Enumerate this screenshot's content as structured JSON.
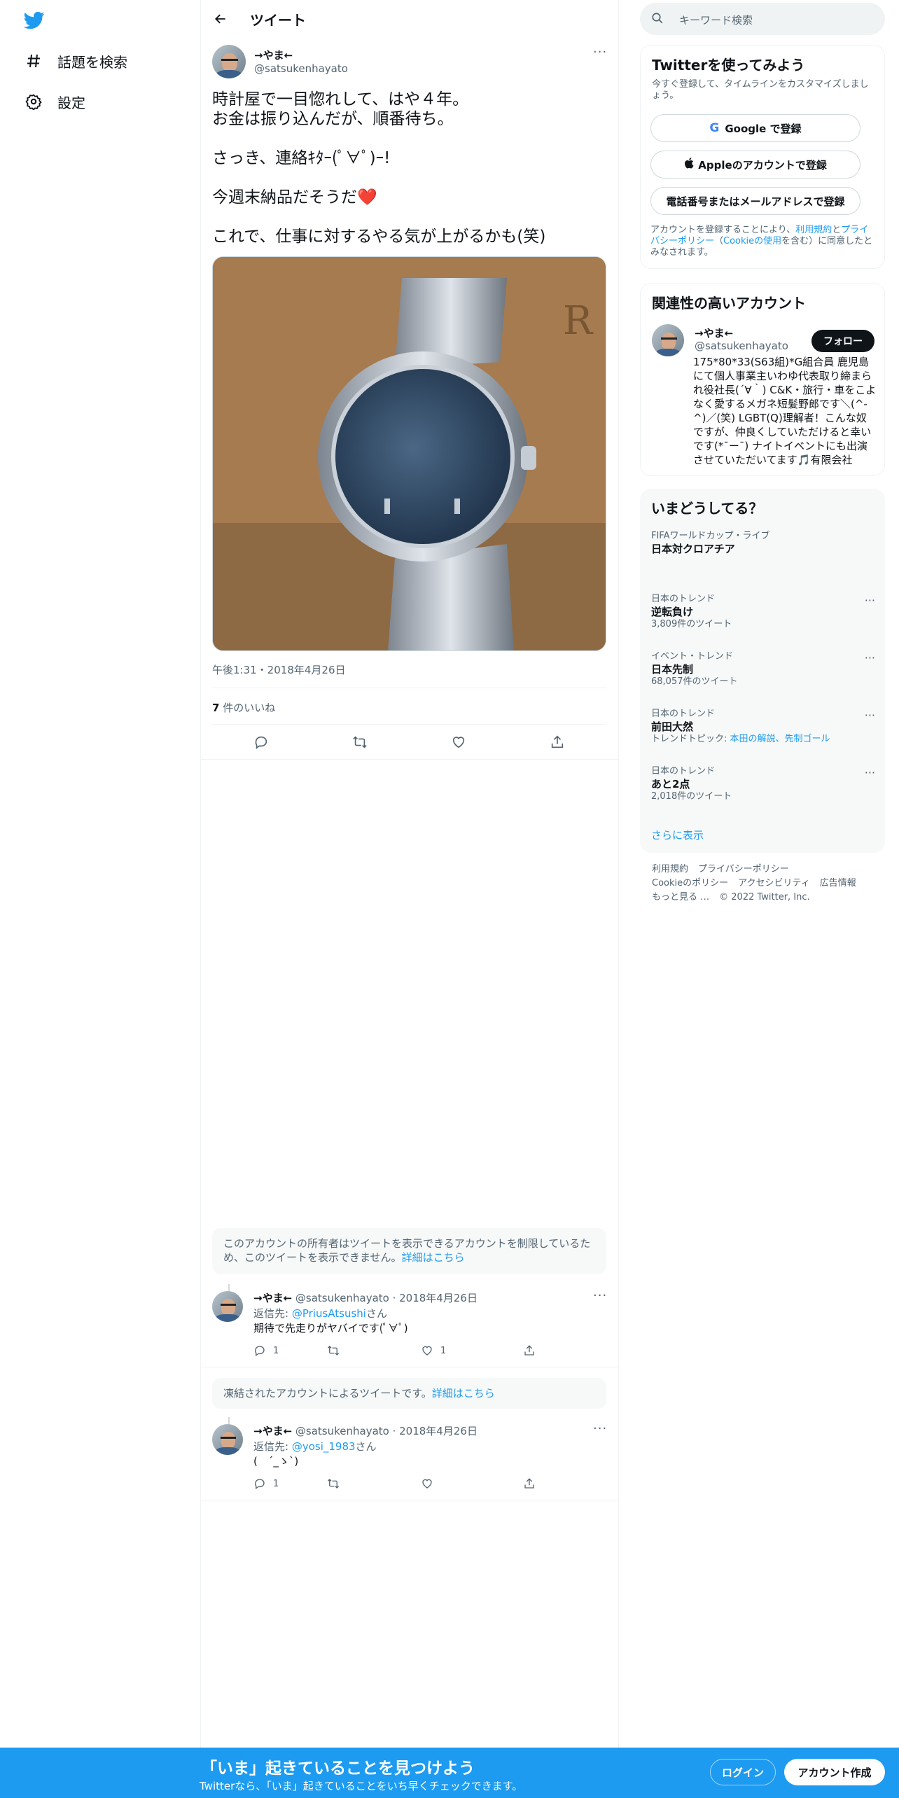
{
  "nav": {
    "explore_label": "話題を検索",
    "settings_label": "設定"
  },
  "header": {
    "title": "ツイート"
  },
  "tweet": {
    "name": "→やま←",
    "handle": "@satsukenhayato",
    "text": "時計屋で一目惚れして、はや４年。\nお金は振り込んだが、順番待ち。\n\nさっき、連絡ｷﾀｰ(ﾟ∀ﾟ)ｰ!\n\n今週末納品だそうだ❤️\n\nこれで、仕事に対するやる気が上がるかも(笑)",
    "timestamp": "午後1:31・2018年4月26日",
    "likes_count": "7",
    "likes_label": " 件のいいね"
  },
  "notices": {
    "restricted_text": "このアカウントの所有者はツイートを表示できるアカウントを制限しているため、このツイートを表示できません。",
    "restricted_link": "詳細はこちら",
    "suspended_text": "凍結されたアカウントによるツイートです。",
    "suspended_link": "詳細はこちら"
  },
  "replies": [
    {
      "name": "→やま←",
      "meta": " @satsukenhayato · 2018年4月26日",
      "reply_prefix": "返信先: ",
      "reply_to": "@PriusAtsushi",
      "reply_suffix": "さん",
      "body": "期待で先走りがヤバイです(ﾟ∀ﾟ)",
      "reply_count": "1",
      "retweet_count": "",
      "like_count": "1"
    },
    {
      "name": "→やま←",
      "meta": " @satsukenhayato · 2018年4月26日",
      "reply_prefix": "返信先: ",
      "reply_to": "@yosi_1983",
      "reply_suffix": "さん",
      "body": "(　´_ゝ`)",
      "reply_count": "1",
      "retweet_count": "",
      "like_count": ""
    }
  ],
  "search": {
    "placeholder": "キーワード検索"
  },
  "signup": {
    "title": "Twitterを使ってみよう",
    "subtitle": "今すぐ登録して、タイムラインをカスタマイズしましょう。",
    "google": "Google で登録",
    "apple": "Appleのアカウントで登録",
    "phone": "電話番号またはメールアドレスで登録",
    "legal_1": "アカウントを登録することにより、",
    "legal_terms": "利用規約",
    "legal_2": "と",
    "legal_privacy": "プライバシーポリシー",
    "legal_3": "（",
    "legal_cookie": "Cookieの使用",
    "legal_4": "を含む）に同意したとみなされます。"
  },
  "related": {
    "title": "関連性の高いアカウント",
    "name": "→やま←",
    "handle": "@satsukenhayato",
    "follow": "フォロー",
    "bio": "175*80*33(S63組)*G組合員 鹿児島にて個人事業主いわゆ代表取り締まられ役社長(´∀｀) C&K・旅行・車をこよなく愛するメガネ短髪野郎です＼(^-^)／(笑) LGBT(Q)理解者！こんな奴ですが、仲良くしていただけると幸いです(*¯ー¯) ナイトイベントにも出演させていただいてます🎵有限会社"
  },
  "trends": {
    "title": "いまどうしてる？",
    "items": [
      {
        "context": "FIFAワールドカップ・ライブ",
        "name": "日本対クロアチア",
        "extra": ""
      },
      {
        "context": "日本のトレンド",
        "name": "逆転負け",
        "extra": "3,809件のツイート"
      },
      {
        "context": "イベント・トレンド",
        "name": "日本先制",
        "extra": "68,057件のツイート"
      },
      {
        "context": "日本のトレンド",
        "name": "前田大然",
        "extra_prefix": "トレンドトピック: ",
        "extra_link": "本田の解説、先制ゴール"
      },
      {
        "context": "日本のトレンド",
        "name": "あと2点",
        "extra": "2,018件のツイート"
      }
    ],
    "show_more": "さらに表示"
  },
  "footer": {
    "terms": "利用規約",
    "privacy": "プライバシーポリシー",
    "cookie": "Cookieのポリシー",
    "accessibility": "アクセシビリティ",
    "ads": "広告情報",
    "more": "もっと見る …",
    "copyright": "© 2022 Twitter, Inc."
  },
  "bottom_bar": {
    "title": "「いま」起きていることを見つけよう",
    "subtitle": "Twitterなら、「いま」起きていることをいち早くチェックできます。",
    "login": "ログイン",
    "signup": "アカウント作成"
  },
  "colors": {
    "brand": "#1d9bf0",
    "text": "#0f1419",
    "muted": "#536471"
  }
}
